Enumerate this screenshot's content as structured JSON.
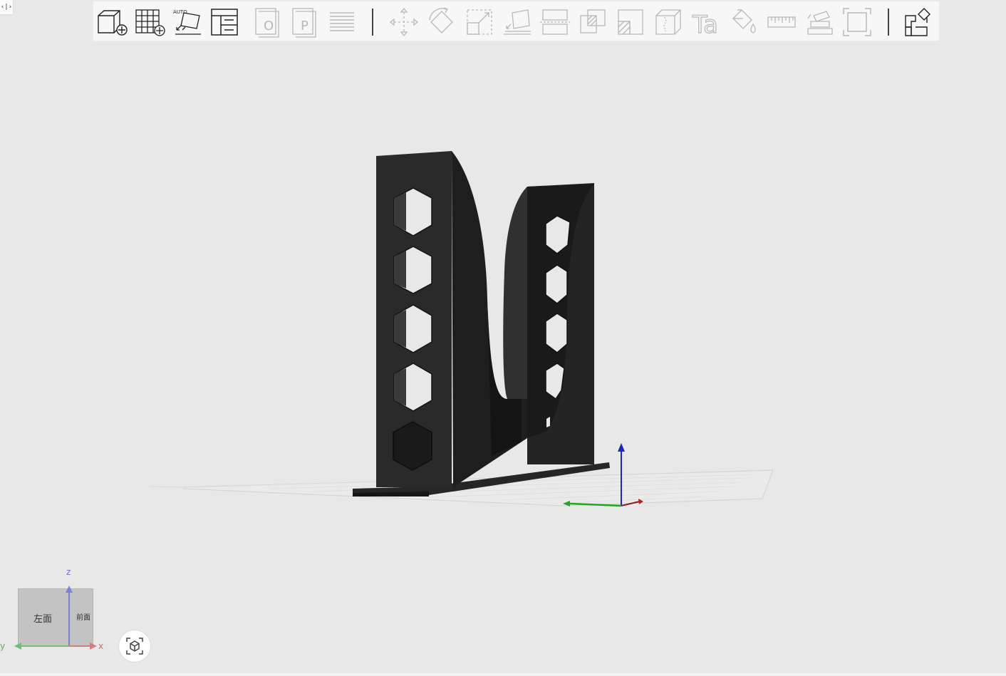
{
  "corner_toggle": {
    "glyph": "‹|›"
  },
  "toolbar": {
    "buttons": [
      {
        "id": "add-model",
        "icon": "cube-plus-icon",
        "enabled": true
      },
      {
        "id": "add-grid",
        "icon": "grid-plus-icon",
        "enabled": true
      },
      {
        "id": "auto-orient",
        "icon": "auto-orient-icon",
        "label": "AUTO",
        "enabled": true
      },
      {
        "id": "layout",
        "icon": "layout-icon",
        "enabled": true
      },
      {
        "id": "object",
        "icon": "object-icon",
        "label": "O",
        "enabled": false
      },
      {
        "id": "plate",
        "icon": "plate-icon",
        "label": "P",
        "enabled": false
      },
      {
        "id": "layers",
        "icon": "layers-icon",
        "enabled": false
      },
      {
        "id": "move",
        "icon": "move-icon",
        "enabled": false
      },
      {
        "id": "rotate",
        "icon": "rotate-icon",
        "enabled": false
      },
      {
        "id": "scale",
        "icon": "scale-icon",
        "enabled": false
      },
      {
        "id": "lay-on-face",
        "icon": "lay-on-face-icon",
        "enabled": false
      },
      {
        "id": "cut",
        "icon": "cut-icon",
        "enabled": false
      },
      {
        "id": "boolean",
        "icon": "boolean-icon",
        "enabled": false
      },
      {
        "id": "support-paint",
        "icon": "support-paint-icon",
        "enabled": false
      },
      {
        "id": "seam-paint",
        "icon": "seam-paint-icon",
        "enabled": false
      },
      {
        "id": "text",
        "icon": "text-icon",
        "label": "Ta",
        "enabled": false
      },
      {
        "id": "color-paint",
        "icon": "color-paint-icon",
        "enabled": false
      },
      {
        "id": "measure",
        "icon": "ruler-icon",
        "enabled": false
      },
      {
        "id": "assembly",
        "icon": "assembly-icon",
        "enabled": false
      },
      {
        "id": "fit-view",
        "icon": "fit-view-icon",
        "enabled": false
      },
      {
        "id": "split",
        "icon": "split-icon",
        "enabled": true
      }
    ]
  },
  "view_cube": {
    "face_left": "左面",
    "face_front": "前面",
    "axis_x": "x",
    "axis_y": "y",
    "axis_z": "z"
  },
  "colors": {
    "background": "#e8e8e8",
    "model": "#1f1f1f",
    "axis_x": "#b22222",
    "axis_y": "#22a622",
    "axis_z": "#1a2ab8",
    "cube_axis_x": "#d08080",
    "cube_axis_y": "#70c070",
    "cube_axis_z": "#8080d0"
  }
}
